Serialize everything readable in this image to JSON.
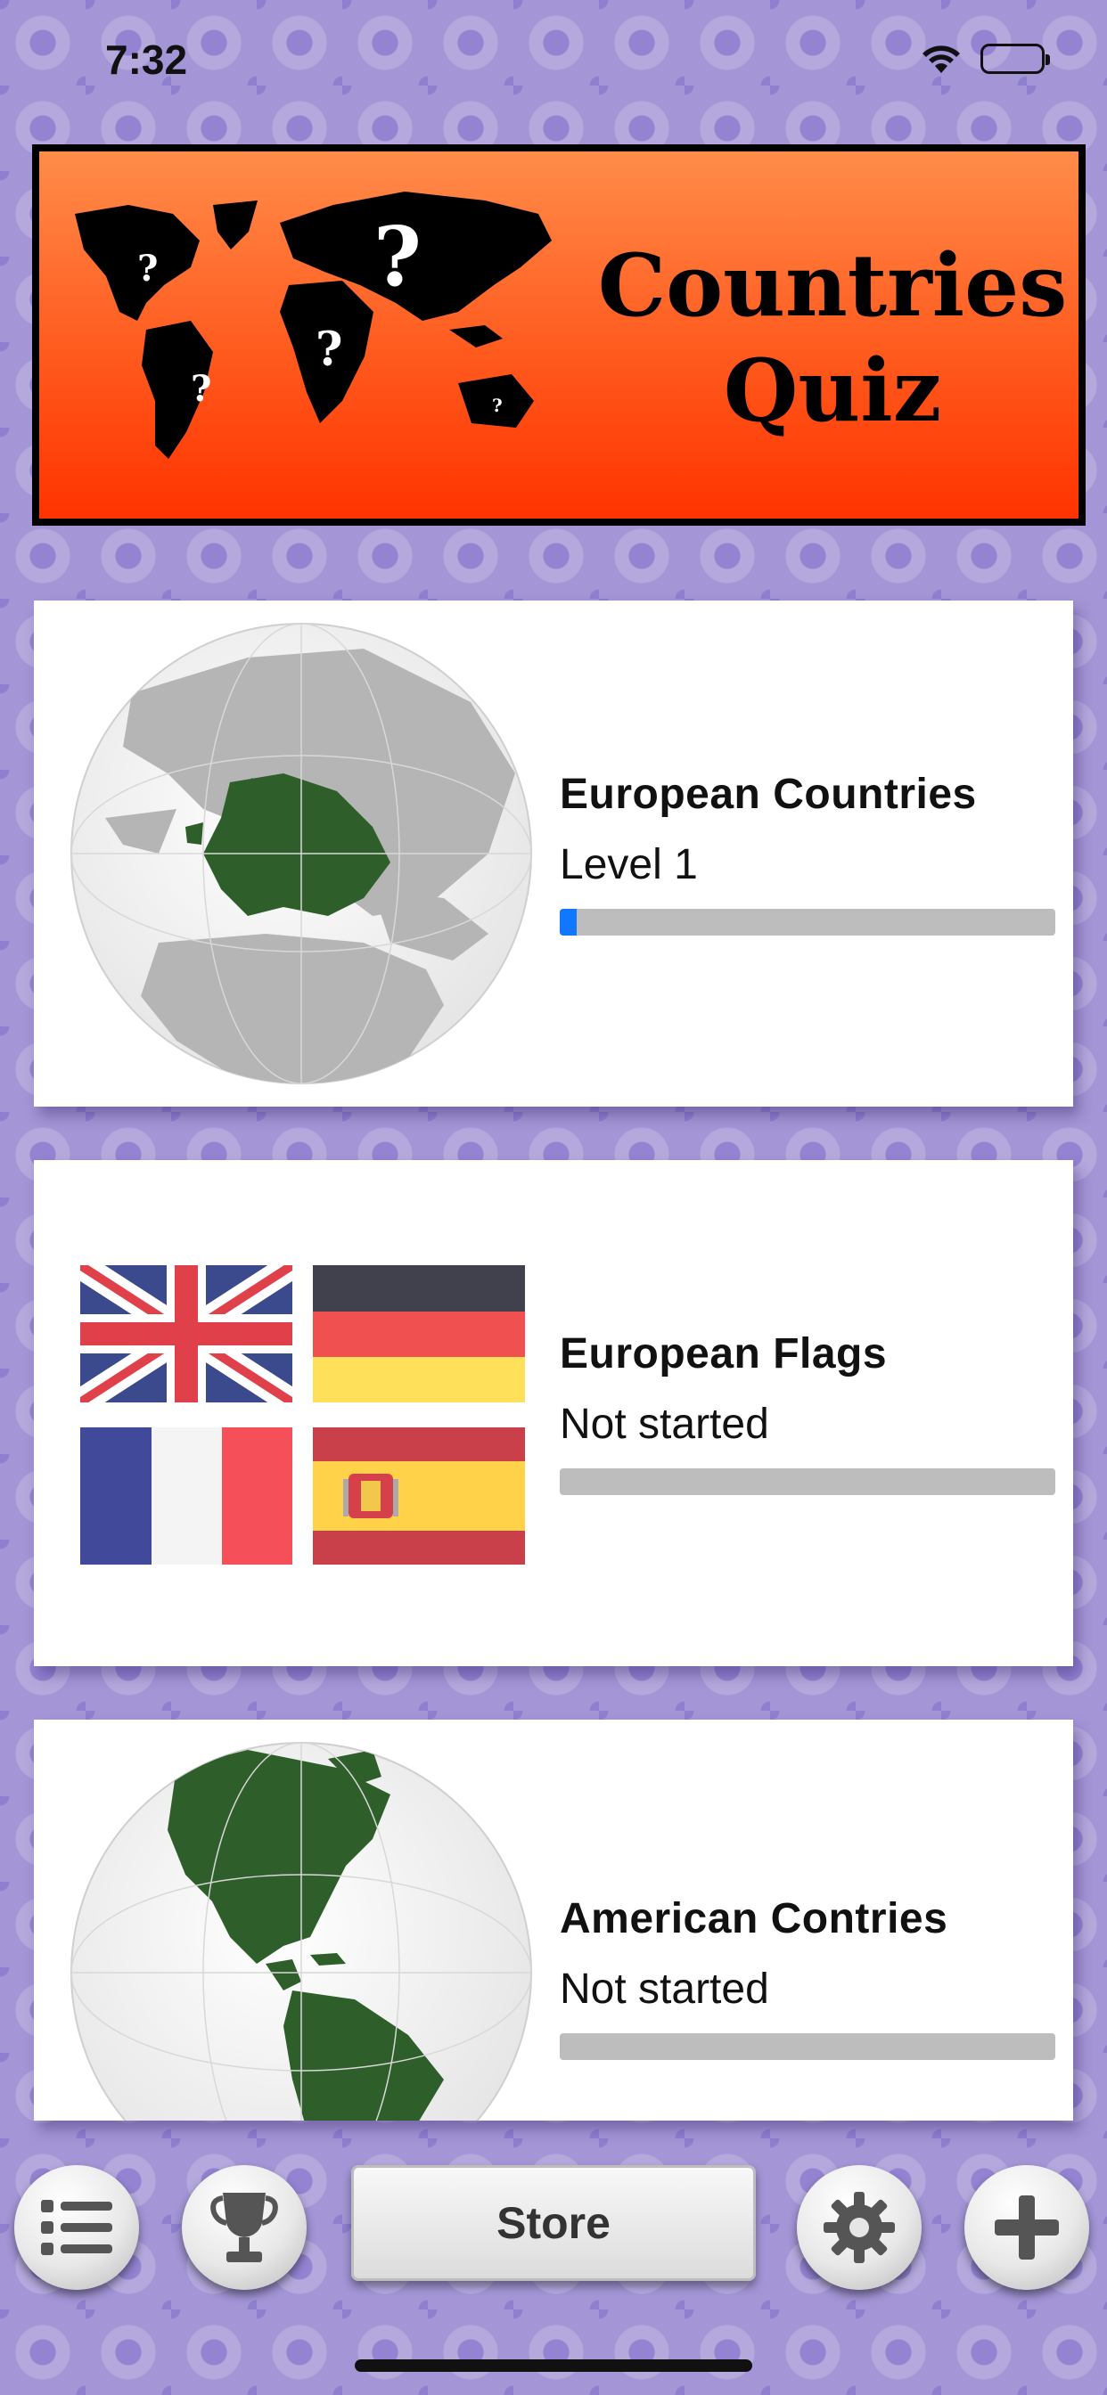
{
  "status_bar": {
    "time": "7:32",
    "icons": [
      "wifi-icon",
      "battery-icon"
    ]
  },
  "header": {
    "title_line1": "Countries",
    "title_line2": "Quiz",
    "logo_icon": "world-map-question-icon",
    "colors": {
      "gradient_top": "#ff8c4a",
      "gradient_bottom": "#ff3300",
      "border": "#000000"
    }
  },
  "quizzes": [
    {
      "title": "European Countries",
      "status": "Level 1",
      "progress": 0.035,
      "image": "europe-globe-icon"
    },
    {
      "title": "European Flags",
      "status": "Not started",
      "progress": 0,
      "image": "european-flags-icon"
    },
    {
      "title": "American Contries",
      "status": "Not started",
      "progress": 0,
      "image": "americas-globe-icon"
    }
  ],
  "toolbar": {
    "store_label": "Store",
    "buttons": [
      "list-icon",
      "trophy-icon",
      "gear-icon",
      "plus-icon"
    ]
  },
  "colors": {
    "background": "#a395d6",
    "progress_fill": "#1177ff",
    "progress_track": "#bdbdbd",
    "land_highlight": "#2e5e2a"
  }
}
